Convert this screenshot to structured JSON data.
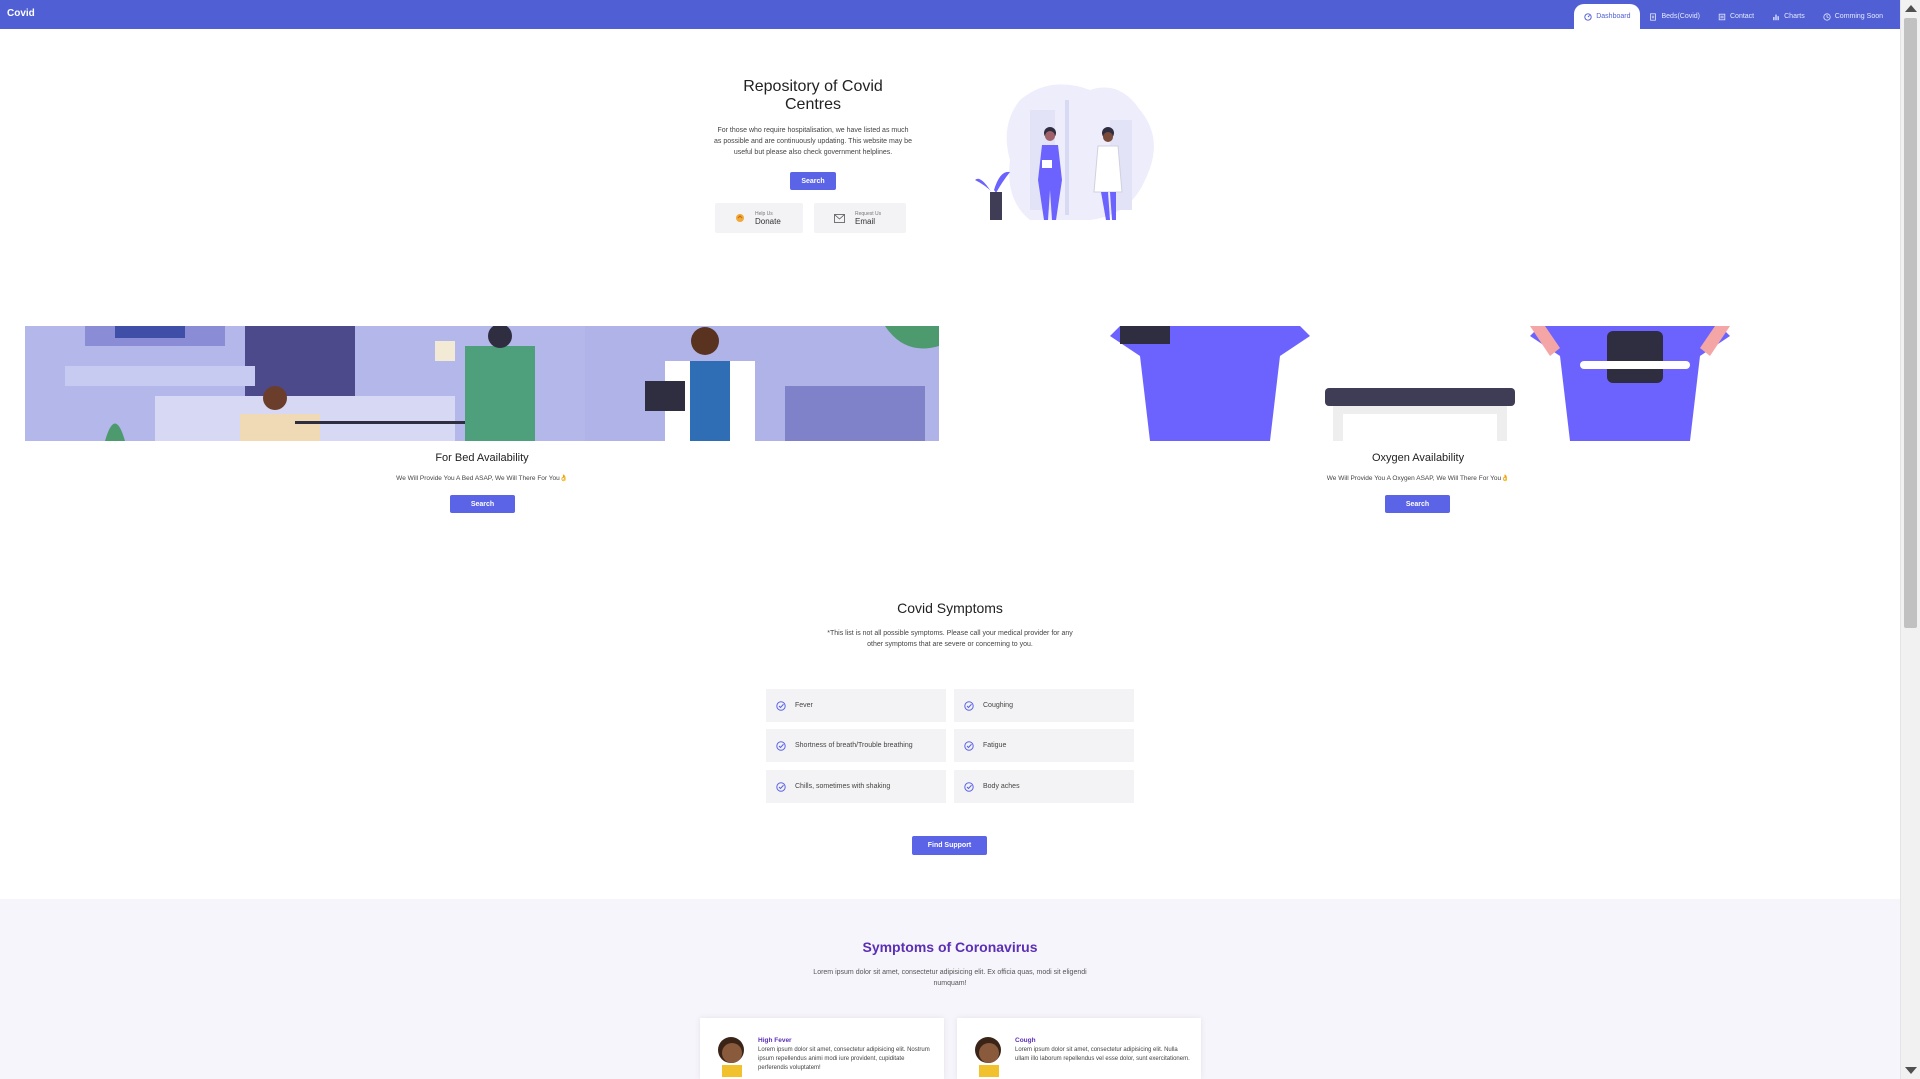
{
  "nav": {
    "brand": "Covid",
    "items": [
      {
        "label": "Dashboard",
        "icon": "dashboard-icon",
        "active": true
      },
      {
        "label": "Beds(Covid)",
        "icon": "document-icon",
        "active": false
      },
      {
        "label": "Contact",
        "icon": "contact-icon",
        "active": false
      },
      {
        "label": "Charts",
        "icon": "chart-icon",
        "active": false
      },
      {
        "label": "Comming Soon",
        "icon": "clock-icon",
        "active": false
      }
    ]
  },
  "hero": {
    "title": "Repository of Covid Centres",
    "text": "For those who require hospitalisation, we have listed as much as possible and are continuously updating. This website may be useful but please also check government helplines.",
    "search_label": "Search",
    "donate": {
      "small": "Help Us",
      "big": "Donate"
    },
    "email": {
      "small": "Request Us",
      "big": "Email"
    }
  },
  "bed": {
    "title": "For Bed Availability",
    "text": "We Will Provide You A Bed ASAP, We Will There For You👌",
    "search_label": "Search"
  },
  "oxygen": {
    "title": "Oxygen Availability",
    "text": "We Will Provide You A Oxygen ASAP, We Will There For You👌",
    "search_label": "Search"
  },
  "symptoms": {
    "title": "Covid Symptoms",
    "text": "*This list is not all possible symptoms. Please call your medical provider for any other symptoms that are severe or concerning to you.",
    "items": [
      "Fever",
      "Coughing",
      "Shortness of breath/Trouble breathing",
      "Fatigue",
      "Chills, sometimes with shaking",
      "Body aches"
    ],
    "find_support_label": "Find Support"
  },
  "coronavirus": {
    "title": "Symptoms of Coronavirus",
    "text": "Lorem ipsum dolor sit amet, consectetur adipisicing elit. Ex officia quas, modi sit eligendi numquam!",
    "cards": [
      {
        "title": "High Fever",
        "desc": "Lorem ipsum dolor sit amet, consectetur adipisicing elit. Nostrum ipsum repellendus animi modi iure provident, cupiditate perferendis voluptatem!"
      },
      {
        "title": "Cough",
        "desc": "Lorem ipsum dolor sit amet, consectetur adipisicing elit. Nulla ullam illo laborum repellendus vel esse dolor, sunt exercitationem."
      }
    ]
  },
  "colors": {
    "nav": "#5060d4",
    "button": "#5b63e6",
    "accent_purple": "#5b2fb5"
  }
}
